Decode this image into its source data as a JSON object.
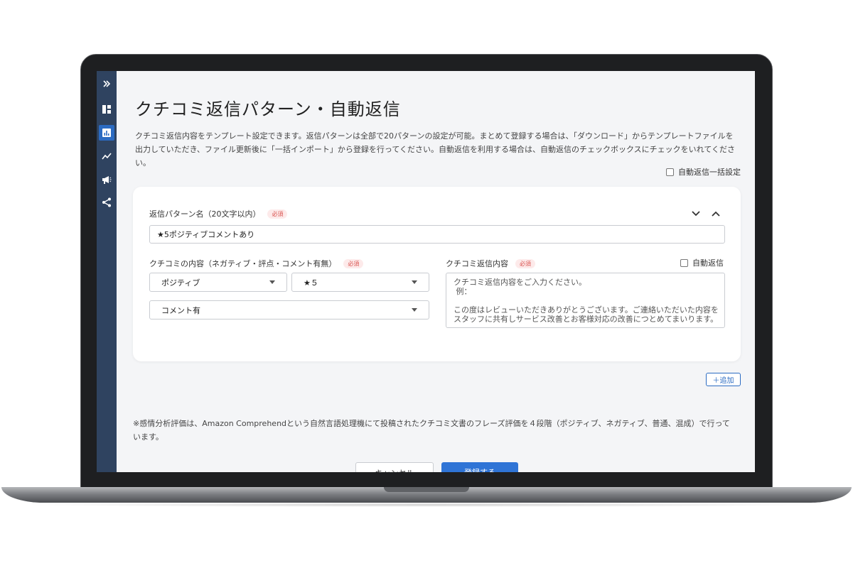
{
  "page": {
    "title": "クチコミ返信パターン・自動返信",
    "description": "クチコミ返信内容をテンプレート設定できます。返信パターンは全部で20パターンの設定が可能。まとめて登録する場合は、「ダウンロード」からテンプレートファイルを出力していただき、ファイル更新後に「一括インポート」から登録を行ってください。自動返信を利用する場合は、自動返信のチェックボックスにチェックをいれてください。",
    "bulk_auto_reply_label": "自動返信一括設定"
  },
  "sidebar": {
    "items": [
      {
        "icon": "double-chevron-right-icon"
      },
      {
        "icon": "dashboard-icon"
      },
      {
        "icon": "bar-chart-icon"
      },
      {
        "icon": "trend-line-icon"
      },
      {
        "icon": "megaphone-icon"
      },
      {
        "icon": "share-icon"
      }
    ]
  },
  "pattern": {
    "name_label": "返信パターン名（20文字以内）",
    "required": "必須",
    "name_value": "★5ポジティブコメントあり",
    "review_content_label": "クチコミの内容（ネガティブ・評点・コメント有無）",
    "sentiment_value": "ポジティブ",
    "rating_value": "★５",
    "comment_value": "コメント有",
    "reply_content_label": "クチコミ返信内容",
    "auto_reply_label": "自動返信",
    "reply_placeholder": "クチコミ返信内容をご入力ください。\n 例：\n\nこの度はレビューいただきありがとうございます。ご連絡いただいた内容を\nスタッフに共有しサービス改善とお客様対応の改善につとめてまいります。"
  },
  "add_button": "＋追加",
  "note": "※感情分析評価は、Amazon Comprehendという自然言語処理機にて投稿されたクチコミ文書のフレーズ評価を４段階（ポジティブ、ネガティブ、普通、混成）で行っています。",
  "footer": {
    "cancel_label": "キャンセル",
    "submit_label": "登録する"
  },
  "colors": {
    "sidebar": "#2f4360",
    "accent": "#2f74d6",
    "required": "#d9534f"
  }
}
